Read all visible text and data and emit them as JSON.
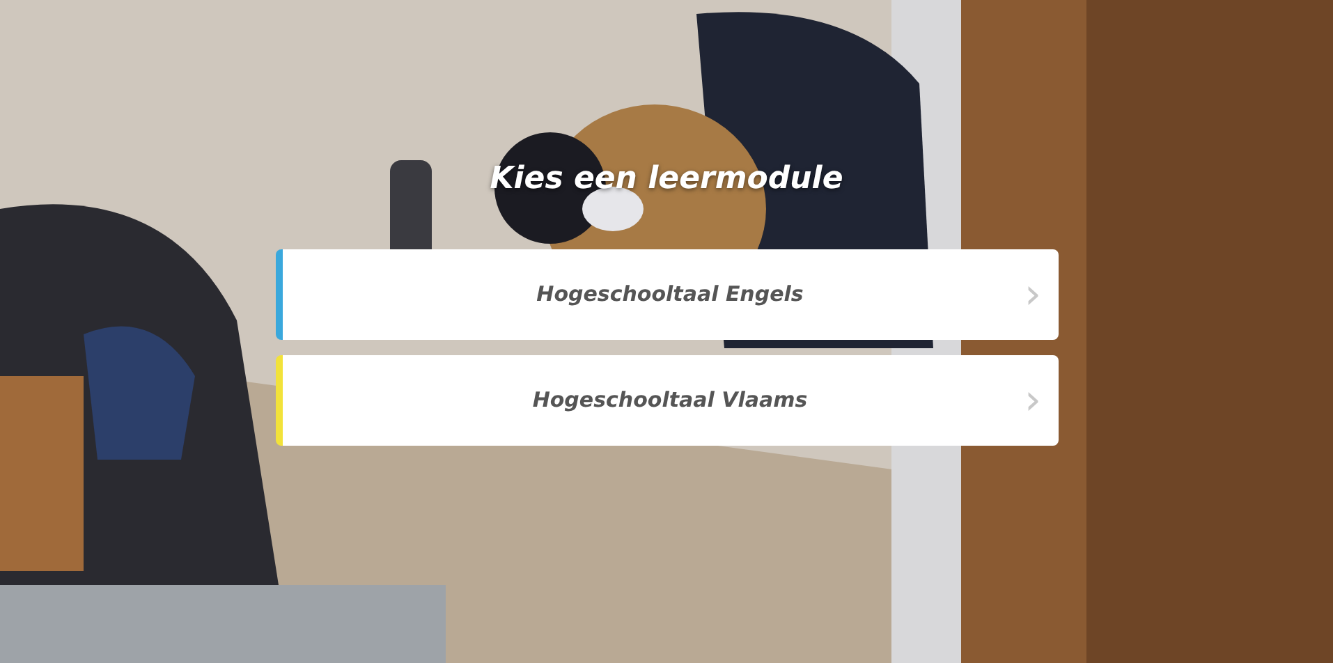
{
  "title": "Kies een leermodule",
  "modules": [
    {
      "label": "Hogeschooltaal Engels",
      "color": "#3aa8dc",
      "chevron": "›"
    },
    {
      "label": "Hogeschooltaal Vlaams",
      "color": "#f2e23a",
      "chevron": "›"
    }
  ]
}
